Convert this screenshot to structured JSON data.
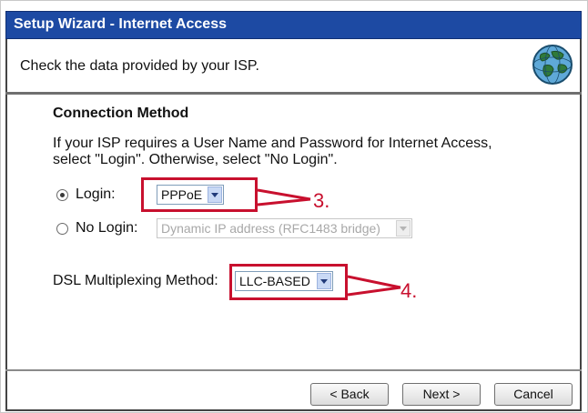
{
  "window": {
    "title": "Setup Wizard - Internet Access"
  },
  "header": {
    "message": "Check the data provided by your ISP."
  },
  "section": {
    "title": "Connection Method",
    "description_line1": "If your ISP requires a User Name and Password for Internet Access,",
    "description_line2": "select \"Login\". Otherwise, select \"No Login\"."
  },
  "login_option": {
    "label": "Login:",
    "selected": true,
    "select_value": "PPPoE"
  },
  "no_login_option": {
    "label": "No Login:",
    "selected": false,
    "select_value": "Dynamic IP address (RFC1483 bridge)"
  },
  "dsl": {
    "label": "DSL Multiplexing Method:",
    "select_value": "LLC-BASED"
  },
  "annotations": {
    "step3": "3.",
    "step4": "4."
  },
  "buttons": {
    "back": "< Back",
    "next": "Next >",
    "cancel": "Cancel"
  },
  "colors": {
    "titlebar": "#1d4aa3",
    "annotation": "#c8102e"
  }
}
